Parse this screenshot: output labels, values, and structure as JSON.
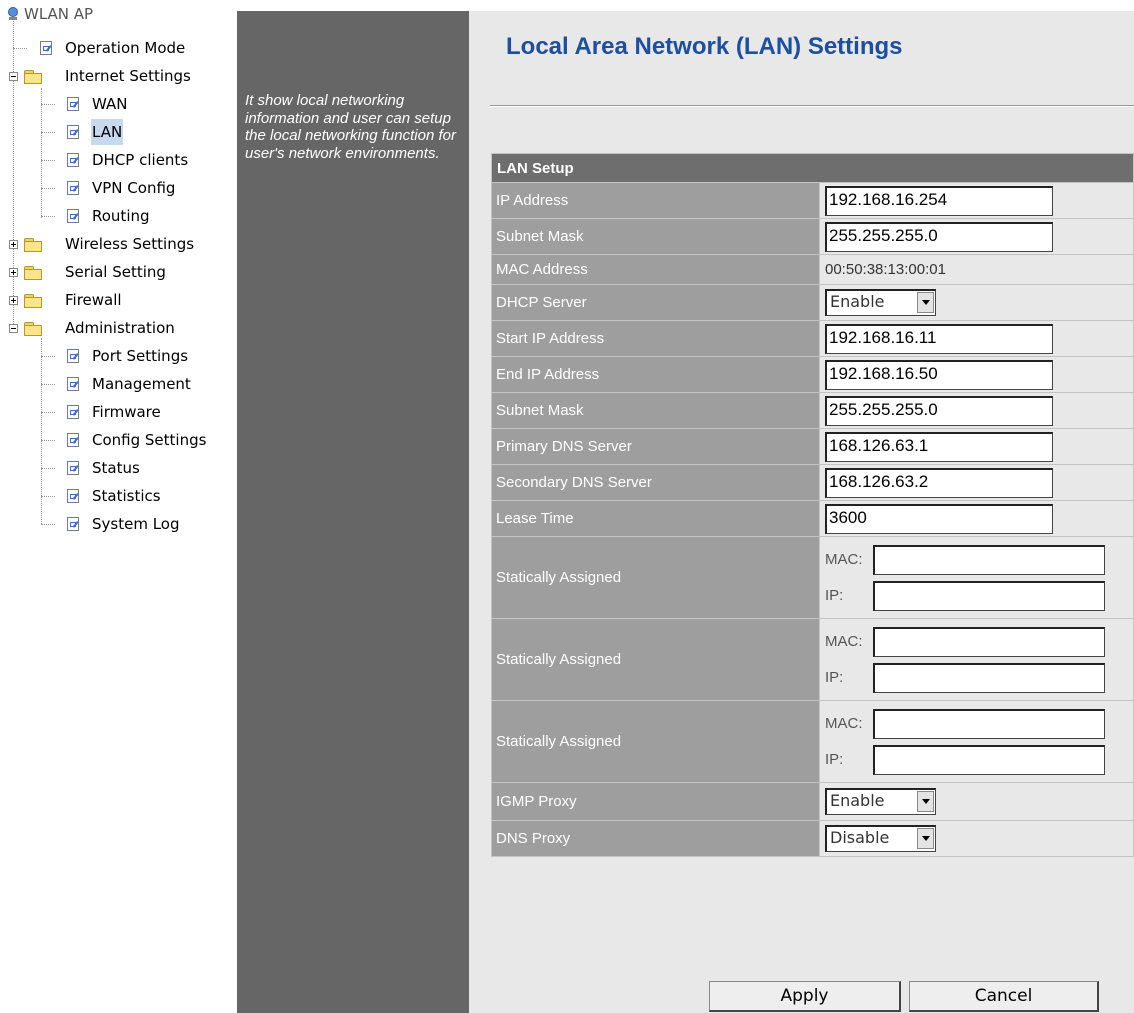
{
  "tree": {
    "root": "WLAN AP",
    "items": [
      {
        "label": "Operation Mode"
      },
      {
        "label": "Internet Settings"
      },
      {
        "label": "WAN"
      },
      {
        "label": "LAN"
      },
      {
        "label": "DHCP clients"
      },
      {
        "label": "VPN Config"
      },
      {
        "label": "Routing"
      },
      {
        "label": "Wireless Settings"
      },
      {
        "label": "Serial Setting"
      },
      {
        "label": "Firewall"
      },
      {
        "label": "Administration"
      },
      {
        "label": "Port Settings"
      },
      {
        "label": "Management"
      },
      {
        "label": "Firmware"
      },
      {
        "label": "Config Settings"
      },
      {
        "label": "Status"
      },
      {
        "label": "Statistics"
      },
      {
        "label": "System Log"
      }
    ]
  },
  "description": "It show local networking information and user can setup the local networking function for user's network environments.",
  "main": {
    "title": "Local Area Network (LAN) Settings",
    "section": "LAN Setup",
    "rows": [
      {
        "label": "IP Address",
        "value": "192.168.16.254"
      },
      {
        "label": "Subnet Mask",
        "value": "255.255.255.0"
      },
      {
        "label": "MAC Address",
        "value": "00:50:38:13:00:01"
      },
      {
        "label": "DHCP Server",
        "value": "Enable"
      },
      {
        "label": "Start IP Address",
        "value": "192.168.16.11"
      },
      {
        "label": "End IP Address",
        "value": "192.168.16.50"
      },
      {
        "label": "Subnet Mask",
        "value": "255.255.255.0"
      },
      {
        "label": "Primary DNS Server",
        "value": "168.126.63.1"
      },
      {
        "label": "Secondary DNS Server",
        "value": "168.126.63.2"
      },
      {
        "label": "Lease Time",
        "value": "3600"
      }
    ],
    "static_label": "Statically Assigned",
    "mac_label": "MAC:",
    "ip_label": "IP:",
    "igmp_proxy": {
      "label": "IGMP Proxy",
      "value": "Enable"
    },
    "dns_proxy": {
      "label": "DNS Proxy",
      "value": "Disable"
    },
    "apply_label": "Apply",
    "cancel_label": "Cancel"
  }
}
